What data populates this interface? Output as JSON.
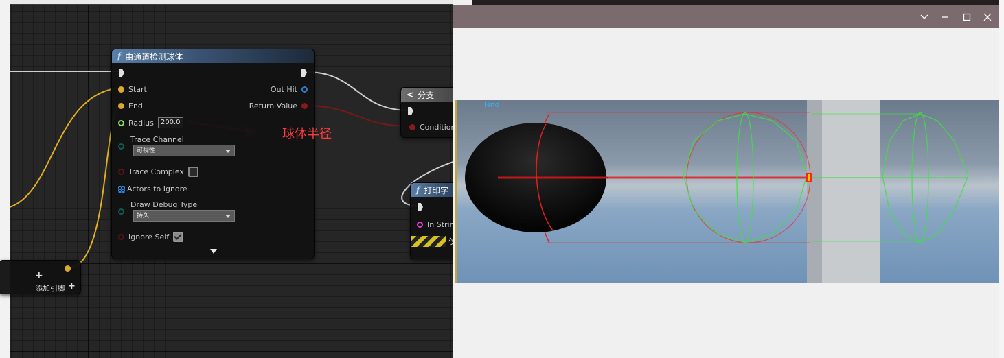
{
  "node_main": {
    "title": "由通道检测球体",
    "pins": {
      "start": "Start",
      "end": "End",
      "radius": "Radius",
      "radius_value": "200.0",
      "trace_channel": "Trace Channel",
      "trace_channel_value": "可视性",
      "trace_complex": "Trace Complex",
      "actors_to_ignore": "Actors to Ignore",
      "draw_debug_type": "Draw Debug Type",
      "draw_debug_value": "持久",
      "ignore_self": "Ignore Self",
      "out_hit": "Out Hit",
      "return_value": "Return Value"
    }
  },
  "node_branch": {
    "title": "分支",
    "condition": "Condition"
  },
  "node_print": {
    "title": "打印字",
    "in_string": "In Strin",
    "dev_only": "仅"
  },
  "node_add": {
    "label": "添加引脚"
  },
  "annotation": {
    "text": "球体半径",
    "color": "#ff3b3b"
  },
  "viewport": {
    "find_label": "Find"
  },
  "window_controls": {
    "dropdown_icon": "chevron-down-icon",
    "minimize_icon": "minimize-icon",
    "maximize_icon": "maximize-icon",
    "close_icon": "close-icon"
  },
  "colors": {
    "exec": "#e0e0e0",
    "vector_pin": "#d8a92a",
    "float_pin": "#8de05c",
    "struct_pin": "#2f7fc8",
    "bool_pin": "#8a1a1a",
    "string_pin": "#e23fd7",
    "node_header": "#3b5576",
    "window_titlebar": "#7b6a6e"
  }
}
